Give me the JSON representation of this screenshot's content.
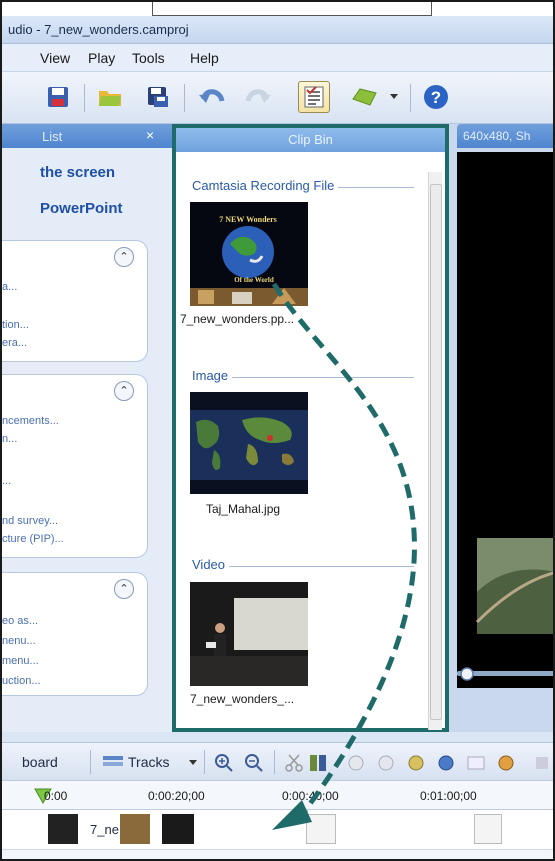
{
  "window": {
    "title": "udio - 7_new_wonders.camproj"
  },
  "menu": {
    "items": [
      "View",
      "Play",
      "Tools",
      "Help"
    ]
  },
  "task_list": {
    "header": "List",
    "close_glyph": "×",
    "top_links": [
      "the screen",
      "PowerPoint"
    ],
    "collapse_glyph": "⌃",
    "groups": [
      {
        "links": [
          "a...",
          "tion...",
          "era..."
        ]
      },
      {
        "links": [
          "ncements...",
          "n...",
          "...",
          "nd survey...",
          "cture (PIP)..."
        ]
      },
      {
        "links": [
          "eo as...",
          "nenu...",
          "menu...",
          "uction..."
        ]
      }
    ]
  },
  "clip_bin": {
    "header": "Clip Bin",
    "sections": [
      {
        "title": "Camtasia Recording File",
        "thumb_text_top": "7 NEW Wonders",
        "thumb_text_bottom": "Of the World",
        "caption": "7_new_wonders.pp..."
      },
      {
        "title": "Image",
        "caption": "Taj_Mahal.jpg"
      },
      {
        "title": "Video",
        "caption": "7_new_wonders_..."
      }
    ]
  },
  "preview": {
    "header": "640x480, Sh"
  },
  "timeline": {
    "storyboard_label": "board",
    "tracks_label": "Tracks",
    "ticks": [
      "0:00",
      "0:00:20;00",
      "0:00:40;00",
      "0:01:00;00"
    ],
    "track_clip_label": "7_ne"
  },
  "colors": {
    "accent": "#1e6b6a",
    "panel_header": "#5a8fd6",
    "link": "#1f4fa6"
  }
}
